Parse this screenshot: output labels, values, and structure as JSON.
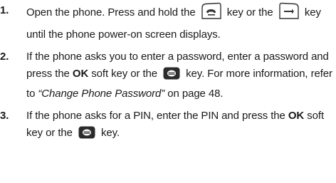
{
  "steps": [
    {
      "number": "1.",
      "part1": "Open the phone. Press and hold the",
      "icon1": "end-power-key-icon",
      "part2": "key or the",
      "icon2": "end-key-icon",
      "part3": "key until the phone power-on screen displays."
    },
    {
      "number": "2.",
      "part1": "If the phone asks you to enter a password, enter a password and press the",
      "bold1": "OK",
      "part2": "soft key or the",
      "icon1": "ok-key-icon",
      "part3": "key. For more information, refer to",
      "italic_ref": "“Change Phone Password”",
      "part4": "on page 48."
    },
    {
      "number": "3.",
      "part1": "If the phone asks for a PIN, enter the PIN and press the",
      "bold1": "OK",
      "part2": "soft key or the",
      "icon1": "ok-key-icon",
      "part3": "key."
    }
  ]
}
